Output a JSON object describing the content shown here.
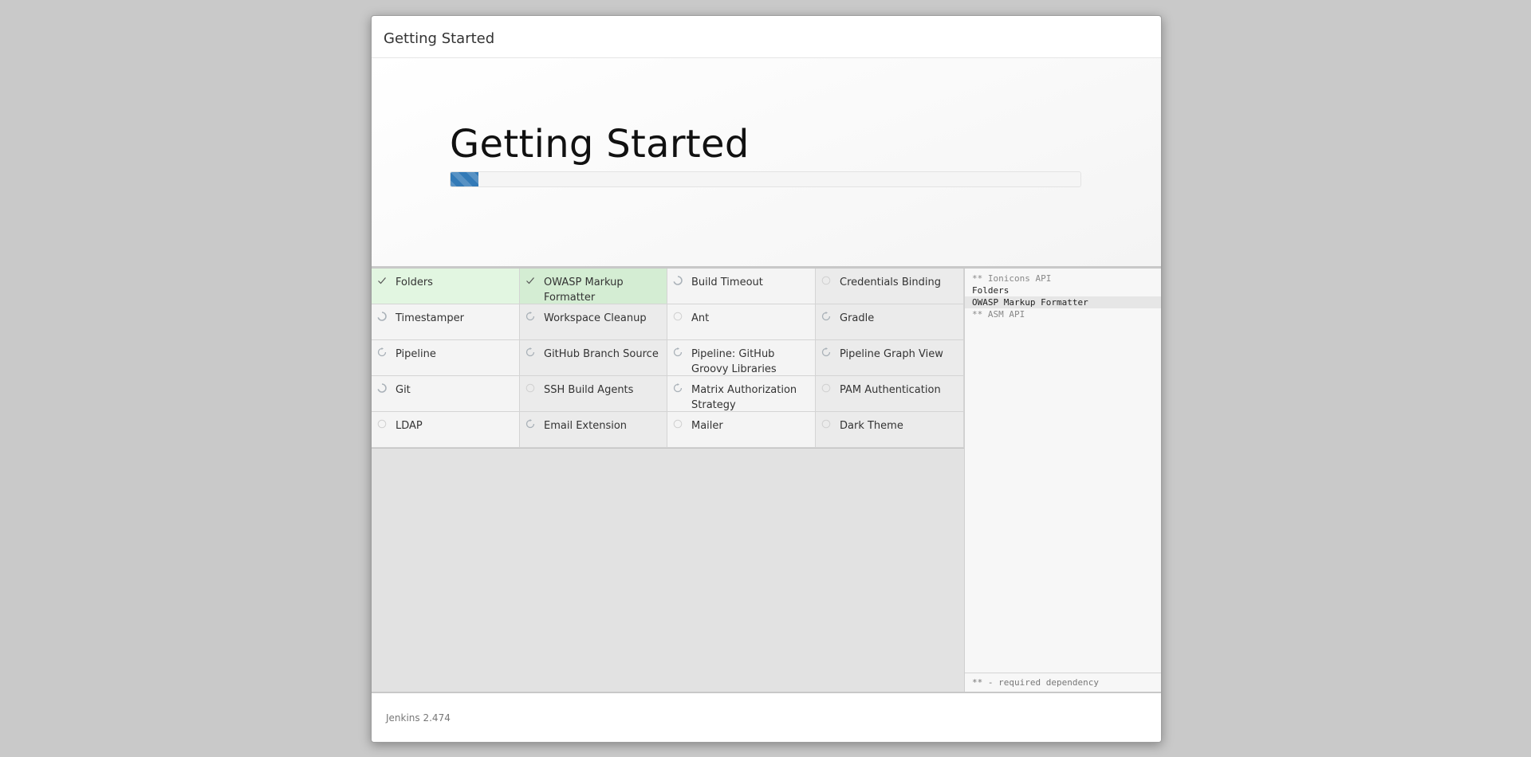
{
  "header": {
    "title": "Getting Started"
  },
  "jumbotron": {
    "heading": "Getting Started",
    "progress_percent": 4.4
  },
  "plugins": [
    {
      "label": "Folders",
      "status": "success"
    },
    {
      "label": "OWASP Markup Formatter",
      "status": "success"
    },
    {
      "label": "Build Timeout",
      "status": "installing"
    },
    {
      "label": "Credentials Binding",
      "status": "pending"
    },
    {
      "label": "Timestamper",
      "status": "installing"
    },
    {
      "label": "Workspace Cleanup",
      "status": "dependency"
    },
    {
      "label": "Ant",
      "status": "pending"
    },
    {
      "label": "Gradle",
      "status": "dependency"
    },
    {
      "label": "Pipeline",
      "status": "dependency"
    },
    {
      "label": "GitHub Branch Source",
      "status": "dependency"
    },
    {
      "label": "Pipeline: GitHub Groovy Libraries",
      "status": "dependency"
    },
    {
      "label": "Pipeline Graph View",
      "status": "dependency"
    },
    {
      "label": "Git",
      "status": "installing"
    },
    {
      "label": "SSH Build Agents",
      "status": "pending"
    },
    {
      "label": "Matrix Authorization Strategy",
      "status": "dependency"
    },
    {
      "label": "PAM Authentication",
      "status": "pending"
    },
    {
      "label": "LDAP",
      "status": "pending"
    },
    {
      "label": "Email Extension",
      "status": "dependency"
    },
    {
      "label": "Mailer",
      "status": "pending"
    },
    {
      "label": "Dark Theme",
      "status": "pending"
    }
  ],
  "log": {
    "lines": [
      {
        "text": "** Ionicons API",
        "kind": "dep"
      },
      {
        "text": "Folders",
        "kind": "normal"
      },
      {
        "text": "OWASP Markup Formatter",
        "kind": "current"
      },
      {
        "text": "** ASM API",
        "kind": "dep"
      }
    ],
    "footer": "** - required dependency"
  },
  "footer": {
    "version": "Jenkins 2.474"
  },
  "colors": {
    "accent": "#337ab7",
    "success_bg": "#d4edd3",
    "icon_gray": "#a9b1b8"
  }
}
